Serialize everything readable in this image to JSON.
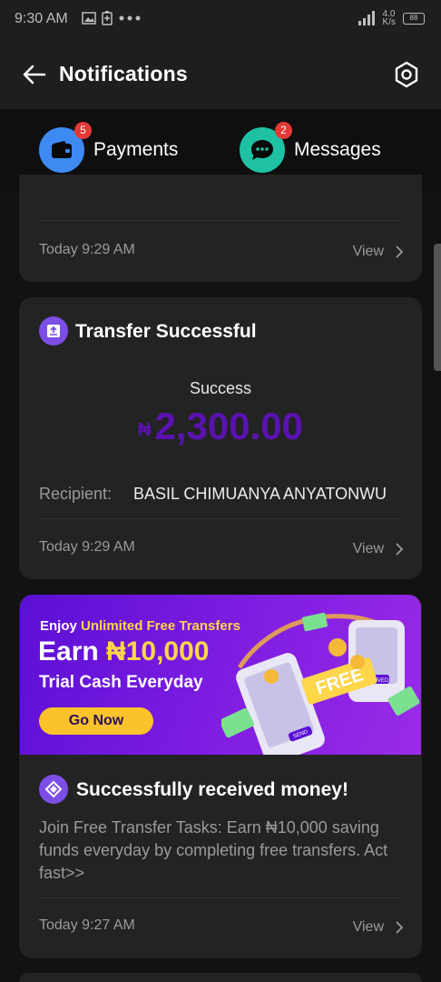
{
  "status_bar": {
    "time": "9:30 AM",
    "speed": "4.0\nK/s",
    "battery": "88",
    "icons": [
      "image-icon",
      "battery-saver-icon",
      "more-dots-icon",
      "signal-icon",
      "wifi-icon"
    ]
  },
  "header": {
    "title": "Notifications",
    "back_icon": "arrow-left-icon",
    "settings_icon": "settings-hexagon-icon"
  },
  "tabs": [
    {
      "label": "Payments",
      "badge": "5",
      "icon": "wallet-icon",
      "color": "#3d8bf2"
    },
    {
      "label": "Messages",
      "badge": "2",
      "icon": "chat-bubble-icon",
      "color": "#1fc1a3"
    }
  ],
  "cards": [
    {
      "time": "Today 9:29 AM",
      "view": "View"
    },
    {
      "title": "Transfer Successful",
      "status": "Success",
      "currency": "₦",
      "amount": "2,300.00",
      "recipient_label": "Recipient:",
      "recipient_value": "BASIL CHIMUANYA ANYATONWU",
      "time": "Today 9:29 AM",
      "view": "View"
    },
    {
      "promo": {
        "line1_prefix": "Enjoy ",
        "line1_highlight": "Unlimited Free Transfers",
        "line2_prefix": "Earn ",
        "line2_highlight": "₦10,000",
        "line3": "Trial Cash Everyday",
        "button": "Go Now",
        "art_free": "FREE",
        "art_send": "SEND",
        "art_received": "RECEIVED"
      },
      "title": "Successfully received money!",
      "body": "Join Free Transfer Tasks: Earn ₦10,000 saving funds everyday by completing free transfers. Act fast>>",
      "time": "Today 9:27 AM",
      "view": "View"
    }
  ],
  "colors": {
    "amount": "#5a12b0",
    "accent_purple": "#7b4fe6",
    "badge_red": "#e53935",
    "go_button": "#fcc22a"
  }
}
